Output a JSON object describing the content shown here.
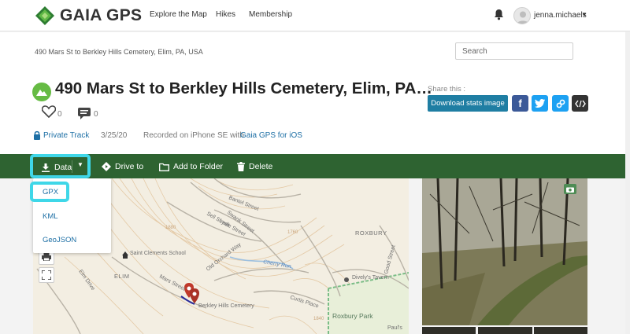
{
  "brand": {
    "name": "GAIA GPS",
    "color": "#2e7d32"
  },
  "nav": {
    "links": [
      "Explore the Map",
      "Hikes",
      "Membership"
    ],
    "username": "jenna.michaels"
  },
  "breadcrumb": "490 Mars St to Berkley Hills Cemetery, Elim, PA, USA",
  "search": {
    "placeholder": "Search"
  },
  "track": {
    "title": "490 Mars St to Berkley Hills Cemetery, Elim, PA…",
    "likes": "0",
    "comments": "0",
    "privacy": "Private Track",
    "date": "3/25/20",
    "recorded_text": "Recorded on iPhone SE with",
    "recorded_app": "Gaia GPS for iOS"
  },
  "share": {
    "label": "Share this :",
    "download_label": "Download stats image",
    "icons": [
      "facebook-icon",
      "twitter-icon",
      "link-icon",
      "embed-icon"
    ]
  },
  "actions": {
    "data": "Data",
    "drive": "Drive to",
    "folder": "Add to Folder",
    "delete": "Delete"
  },
  "dropdown": {
    "items": [
      "GPX",
      "KML",
      "GeoJSON"
    ]
  },
  "map_labels": {
    "streets": [
      "Bantel Street",
      "Swank Street",
      "Sell Street",
      "Lydle Street",
      "Old Orchard Way",
      "Mars Street",
      "Elm Drive",
      "Curtis Place",
      "Good Street",
      "Cherry Run"
    ],
    "places": [
      "ROXBURY",
      "ELIM",
      "Saint Clements School",
      "Berkley Hills Cemetery",
      "Dively's Tavern",
      "Roxbury Park",
      "Paul's"
    ],
    "contours": [
      "1880",
      "1760",
      "1840",
      "1640"
    ]
  },
  "colors": {
    "action_bar": "#2e6331",
    "highlight": "#3fd7e8",
    "link": "#1d6fa5",
    "download_button": "#1f7ea3",
    "facebook": "#3b5998",
    "twitter": "#1da1f2"
  }
}
